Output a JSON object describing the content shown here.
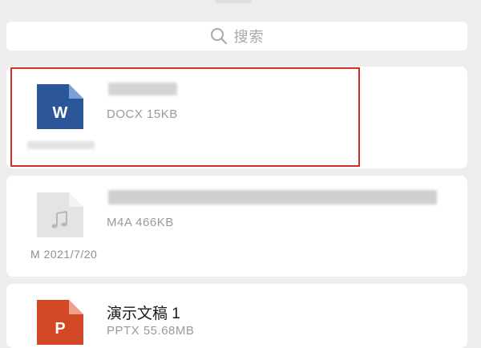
{
  "search": {
    "placeholder": "搜索"
  },
  "files": [
    {
      "type": "DOCX",
      "icon": "word-doc-icon",
      "icon_letter": "W",
      "color": "#2b579a",
      "name": "",
      "meta": "DOCX 15KB",
      "footer": "",
      "highlighted": true
    },
    {
      "type": "M4A",
      "icon": "audio-file-icon",
      "color": "#d3d3d3",
      "name": "",
      "meta": "M4A 466KB",
      "footer": "M   2021/7/20"
    },
    {
      "type": "PPTX",
      "icon": "powerpoint-icon",
      "icon_letter": "P",
      "color": "#d24726",
      "name": "演示文稿 1",
      "meta": "PPTX 55.68MB"
    }
  ],
  "colors": {
    "highlight": "#d42b2b",
    "background": "#ededed"
  }
}
